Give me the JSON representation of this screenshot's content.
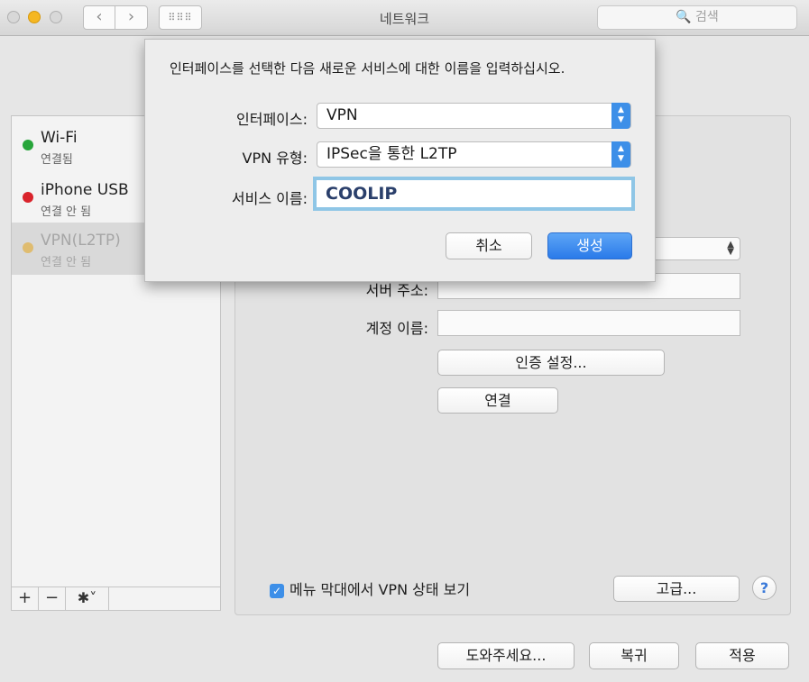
{
  "window": {
    "title": "네트워크",
    "nav_back": "‹",
    "nav_forward": "›",
    "grid_glyph": "⠿⠿⠿",
    "search_placeholder": "🔍 검색"
  },
  "sidebar": {
    "items": [
      {
        "name": "Wi-Fi",
        "status": "연결됨",
        "color": "#27a53a"
      },
      {
        "name": "iPhone USB",
        "status": "연결 안 됨",
        "color": "#d9232b"
      },
      {
        "name": "VPN(L2TP)",
        "status": "연결 안 됨",
        "color": "#e2a92a"
      }
    ],
    "tools": {
      "add": "+",
      "remove": "−",
      "gear": "✱˅"
    }
  },
  "detail": {
    "server_label": "서버 주소:",
    "account_label": "계정 이름:",
    "auth_button": "인증 설정...",
    "connect_button": "연결",
    "show_status_checkbox": "메뉴 막대에서 VPN 상태 보기",
    "show_status_checked": true,
    "advanced_button": "고급...",
    "help_button": "?"
  },
  "sheet": {
    "prompt": "인터페이스를 선택한 다음 새로운 서비스에 대한 이름을 입력하십시오.",
    "interface_label": "인터페이스:",
    "interface_value": "VPN",
    "vpn_type_label": "VPN 유형:",
    "vpn_type_value": "IPSec을 통한 L2TP",
    "service_name_label": "서비스 이름:",
    "service_name_value": "COOLIP",
    "cancel_button": "취소",
    "create_button": "생성"
  },
  "footer": {
    "assist_button": "도와주세요...",
    "revert_button": "복귀",
    "apply_button": "적용"
  },
  "colors": {
    "accent": "#3d8fe8",
    "focus_ring": "#8fc6e6"
  }
}
